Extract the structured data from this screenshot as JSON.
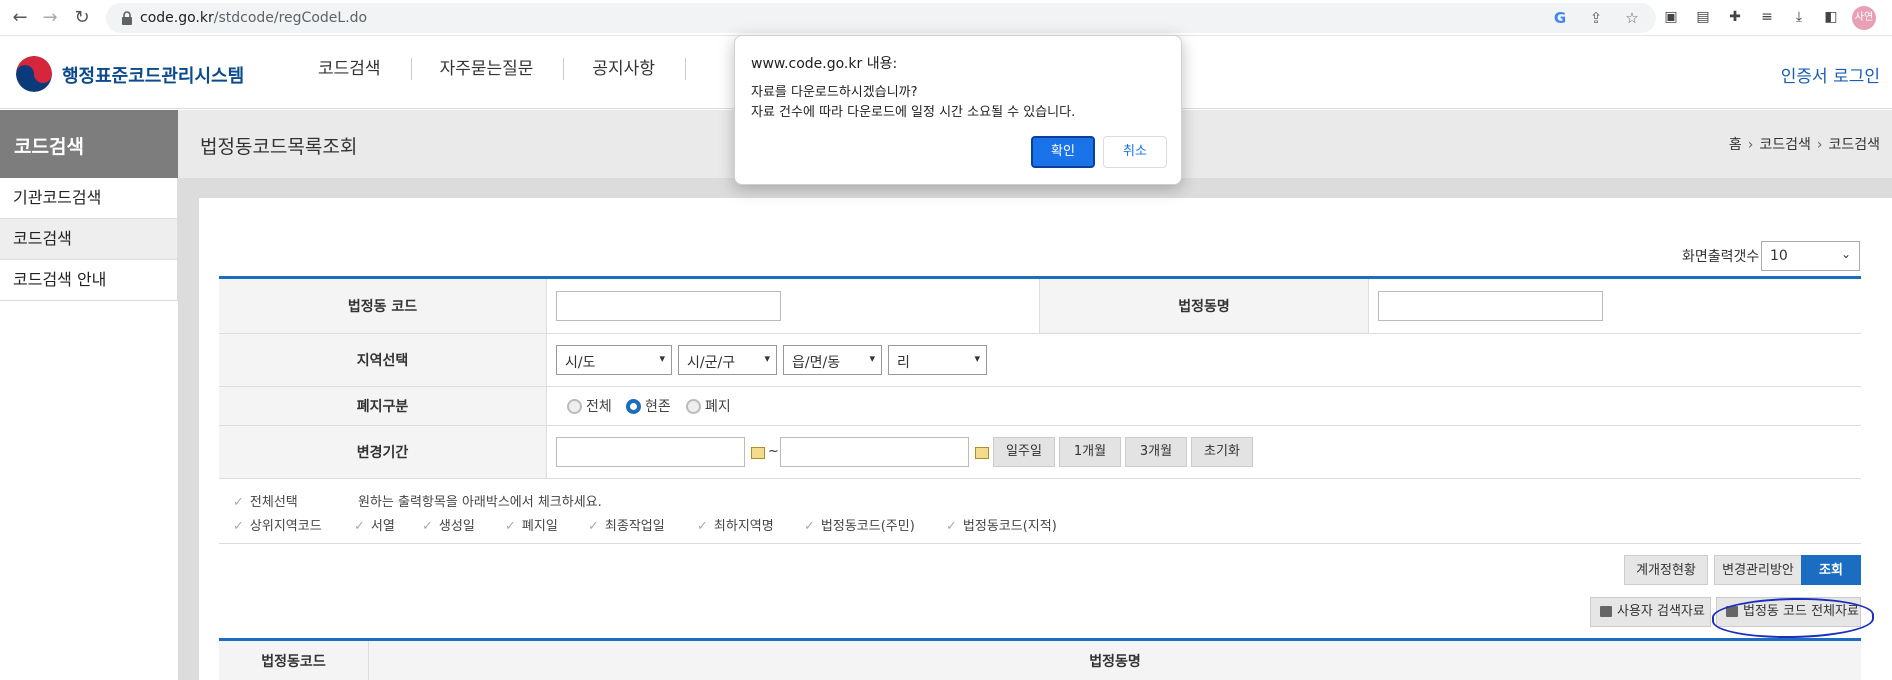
{
  "browser": {
    "url_host": "code.go.kr",
    "url_path": "/stdcode/regCodeL.do",
    "profile_label": "사연"
  },
  "site": {
    "logo_text": "행정표준코드관리시스템",
    "nav": [
      "코드검색",
      "자주묻는질문",
      "공지사항"
    ],
    "login": "인증서 로그인"
  },
  "sidebar": {
    "title": "코드검색",
    "items": [
      {
        "label": "기관코드검색",
        "active": false
      },
      {
        "label": "코드검색",
        "active": true
      },
      {
        "label": "코드검색 안내",
        "active": false
      }
    ]
  },
  "page": {
    "title": "법정동코드목록조회",
    "breadcrumb": [
      "홈",
      "코드검색",
      "코드검색"
    ]
  },
  "rows_per_page": {
    "label": "화면출력갯수",
    "value": "10"
  },
  "form": {
    "code_label": "법정동 코드",
    "code_value": "",
    "name_label": "법정동명",
    "name_value": "",
    "region_label": "지역선택",
    "region_selects": [
      "시/도",
      "시/군/구",
      "읍/면/동",
      "리"
    ],
    "status_label": "폐지구분",
    "status_options": [
      {
        "label": "전체",
        "selected": false
      },
      {
        "label": "현존",
        "selected": true
      },
      {
        "label": "폐지",
        "selected": false
      }
    ],
    "period_label": "변경기간",
    "period_sep": "~",
    "period_buttons": [
      "일주일",
      "1개월",
      "3개월",
      "초기화"
    ]
  },
  "checks": {
    "select_all": "전체선택",
    "hint": "원하는 출력항목을 아래박스에서 체크하세요.",
    "items": [
      "상위지역코드",
      "서열",
      "생성일",
      "폐지일",
      "최종작업일",
      "최하지역명",
      "법정동코드(주민)",
      "법정동코드(지적)"
    ]
  },
  "actions": {
    "btn1": "계개정현황",
    "btn2": "변경관리방안",
    "search": "조회",
    "download_user": "사용자 검색자료",
    "download_all": "법정동 코드 전체자료"
  },
  "result_table": {
    "col1": "법정동코드",
    "col2": "법정동명"
  },
  "dialog": {
    "title": "www.code.go.kr 내용:",
    "line1": "자료를 다운로드하시겠습니까?",
    "line2": "자료 건수에 따라 다운로드에 일정 시간 소요될 수 있습니다.",
    "ok": "확인",
    "cancel": "취소"
  },
  "colors": {
    "accent": "#1a6dc0",
    "annotation": "#1a2fc0"
  }
}
